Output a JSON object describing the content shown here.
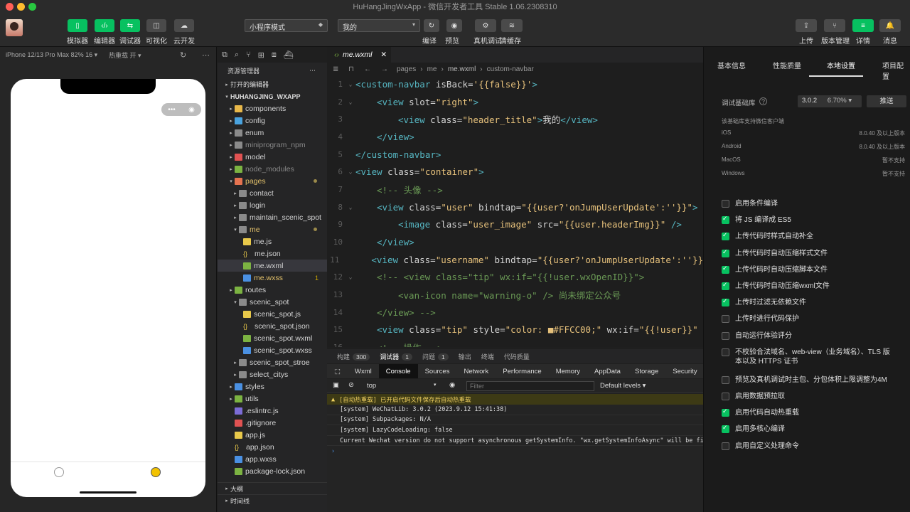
{
  "window": {
    "title": "HuHangJingWxApp - 微信开发者工具 Stable 1.06.2308310"
  },
  "toolbar": {
    "left_buttons": [
      {
        "label": "模拟器",
        "glyph": "▯"
      },
      {
        "label": "编辑器",
        "glyph": "‹/›"
      },
      {
        "label": "调试器",
        "glyph": "⇆"
      },
      {
        "label": "可视化",
        "glyph": "◫"
      },
      {
        "label": "云开发",
        "glyph": "☁"
      }
    ],
    "mode_select": "小程序模式",
    "page_select": "我的",
    "center_buttons": [
      {
        "label": "编译",
        "glyph": "↻"
      },
      {
        "label": "预览",
        "glyph": "◉"
      },
      {
        "label": "真机调试",
        "glyph": "⚙"
      },
      {
        "label": "清缓存",
        "glyph": "≋"
      }
    ],
    "right_buttons": [
      {
        "label": "上传",
        "glyph": "⇪"
      },
      {
        "label": "版本管理",
        "glyph": "⑂"
      },
      {
        "label": "详情",
        "glyph": "≡"
      },
      {
        "label": "消息",
        "glyph": "🔔"
      }
    ]
  },
  "simulator": {
    "device": "iPhone 12/13 Pro Max 82% 16 ▾",
    "hot_reload": "热重载 开 ▾"
  },
  "explorer": {
    "title": "资源管理器",
    "open_editors": "打开的编辑器",
    "root": "HUHANGJING_WXAPP",
    "items": [
      {
        "label": "components",
        "depth": 0,
        "arrow": "▸",
        "color": "#e8b84a"
      },
      {
        "label": "config",
        "depth": 0,
        "arrow": "▸",
        "color": "#4aa3df"
      },
      {
        "label": "enum",
        "depth": 0,
        "arrow": "▸",
        "color": "#8a8a8a"
      },
      {
        "label": "miniprogram_npm",
        "depth": 0,
        "arrow": "▸",
        "color": "#8a8a8a",
        "dim": true
      },
      {
        "label": "model",
        "depth": 0,
        "arrow": "▸",
        "color": "#e05252"
      },
      {
        "label": "node_modules",
        "depth": 0,
        "arrow": "▸",
        "color": "#7cb342",
        "dim": true
      },
      {
        "label": "pages",
        "depth": 0,
        "arrow": "▾",
        "color": "#e57350",
        "mod": "dot"
      },
      {
        "label": "contact",
        "depth": 1,
        "arrow": "▸",
        "color": "#8a8a8a"
      },
      {
        "label": "login",
        "depth": 1,
        "arrow": "▸",
        "color": "#8a8a8a"
      },
      {
        "label": "maintain_scenic_spot",
        "depth": 1,
        "arrow": "▸",
        "color": "#8a8a8a"
      },
      {
        "label": "me",
        "depth": 1,
        "arrow": "▾",
        "color": "#8a8a8a",
        "mod": "dot",
        "yellow": true
      },
      {
        "label": "me.js",
        "depth": 2,
        "arrow": "",
        "color": "#e8c84a"
      },
      {
        "label": "me.json",
        "depth": 2,
        "arrow": "",
        "color": "#e8c84a",
        "brace": true
      },
      {
        "label": "me.wxml",
        "depth": 2,
        "arrow": "",
        "color": "#7cb342",
        "selected": true
      },
      {
        "label": "me.wxss",
        "depth": 2,
        "arrow": "",
        "color": "#4a90e2",
        "mod": "1",
        "yellow": true
      },
      {
        "label": "routes",
        "depth": 0,
        "arrow": "▸",
        "color": "#7cb342"
      },
      {
        "label": "scenic_spot",
        "depth": 1,
        "arrow": "▾",
        "color": "#8a8a8a"
      },
      {
        "label": "scenic_spot.js",
        "depth": 2,
        "arrow": "",
        "color": "#e8c84a"
      },
      {
        "label": "scenic_spot.json",
        "depth": 2,
        "arrow": "",
        "color": "#e8c84a",
        "brace": true
      },
      {
        "label": "scenic_spot.wxml",
        "depth": 2,
        "arrow": "",
        "color": "#7cb342"
      },
      {
        "label": "scenic_spot.wxss",
        "depth": 2,
        "arrow": "",
        "color": "#4a90e2"
      },
      {
        "label": "scenic_spot_stroe",
        "depth": 1,
        "arrow": "▸",
        "color": "#8a8a8a"
      },
      {
        "label": "select_citys",
        "depth": 1,
        "arrow": "▸",
        "color": "#8a8a8a"
      },
      {
        "label": "styles",
        "depth": 0,
        "arrow": "▸",
        "color": "#4a90e2"
      },
      {
        "label": "utils",
        "depth": 0,
        "arrow": "▸",
        "color": "#7cb342"
      },
      {
        "label": ".eslintrc.js",
        "depth": 0,
        "arrow": "",
        "color": "#7c6cd6"
      },
      {
        "label": ".gitignore",
        "depth": 0,
        "arrow": "",
        "color": "#e05252"
      },
      {
        "label": "app.js",
        "depth": 0,
        "arrow": "",
        "color": "#e8c84a"
      },
      {
        "label": "app.json",
        "depth": 0,
        "arrow": "",
        "color": "#e8c84a",
        "brace": true
      },
      {
        "label": "app.wxss",
        "depth": 0,
        "arrow": "",
        "color": "#4a90e2"
      },
      {
        "label": "package-lock.json",
        "depth": 0,
        "arrow": "",
        "color": "#7cb342"
      }
    ],
    "outline": "大纲",
    "timeline": "时间线"
  },
  "editor": {
    "tab": "me.wxml",
    "breadcrumb": [
      "pages",
      "me",
      "me.wxml",
      "custom-navbar"
    ],
    "lines": [
      {
        "n": "1",
        "fold": "⌄",
        "indent": 0,
        "tokens": [
          [
            "c-tag",
            "<custom-navbar"
          ],
          [
            "c-attr",
            " isBack="
          ],
          [
            "c-str",
            "'{{false}}'"
          ],
          [
            "c-tag",
            ">"
          ]
        ]
      },
      {
        "n": "2",
        "fold": "⌄",
        "indent": 1,
        "tokens": [
          [
            "c-tag",
            "<view"
          ],
          [
            "c-attr",
            " slot="
          ],
          [
            "c-str",
            "\"right\""
          ],
          [
            "c-tag",
            ">"
          ]
        ]
      },
      {
        "n": "3",
        "fold": "",
        "indent": 2,
        "tokens": [
          [
            "c-tag",
            "<view"
          ],
          [
            "c-attr",
            " class="
          ],
          [
            "c-str",
            "\"header_title\""
          ],
          [
            "c-tag",
            ">"
          ],
          [
            "c-pun",
            "我的"
          ],
          [
            "c-tag",
            "</view>"
          ]
        ]
      },
      {
        "n": "4",
        "fold": "",
        "indent": 1,
        "tokens": [
          [
            "c-tag",
            "</view>"
          ]
        ]
      },
      {
        "n": "5",
        "fold": "",
        "indent": 0,
        "tokens": [
          [
            "c-tag",
            "</custom-navbar>"
          ]
        ]
      },
      {
        "n": "6",
        "fold": "⌄",
        "indent": 0,
        "tokens": [
          [
            "c-tag",
            "<view"
          ],
          [
            "c-attr",
            " class="
          ],
          [
            "c-str",
            "\"container\""
          ],
          [
            "c-tag",
            ">"
          ]
        ]
      },
      {
        "n": "7",
        "fold": "",
        "indent": 1,
        "tokens": [
          [
            "c-cmt",
            "<!-- 头像 -->"
          ]
        ]
      },
      {
        "n": "8",
        "fold": "⌄",
        "indent": 1,
        "tokens": [
          [
            "c-tag",
            "<view"
          ],
          [
            "c-attr",
            " class="
          ],
          [
            "c-str",
            "\"user\""
          ],
          [
            "c-attr",
            " bindtap="
          ],
          [
            "c-str",
            "\"{{user?'onJumpUserUpdate':''}}\""
          ],
          [
            "c-tag",
            ">"
          ]
        ]
      },
      {
        "n": "9",
        "fold": "",
        "indent": 2,
        "tokens": [
          [
            "c-tag",
            "<image"
          ],
          [
            "c-attr",
            " class="
          ],
          [
            "c-str",
            "\"user_image\""
          ],
          [
            "c-attr",
            " src="
          ],
          [
            "c-str",
            "\"{{user.headerImg}}\""
          ],
          [
            "c-tag",
            " />"
          ]
        ]
      },
      {
        "n": "10",
        "fold": "",
        "indent": 1,
        "tokens": [
          [
            "c-tag",
            "</view>"
          ]
        ]
      },
      {
        "n": "11",
        "fold": "",
        "indent": 1,
        "tokens": [
          [
            "c-tag",
            "<view"
          ],
          [
            "c-attr",
            " class="
          ],
          [
            "c-str",
            "\"username\""
          ],
          [
            "c-attr",
            " bindtap="
          ],
          [
            "c-str",
            "\"{{user?'onJumpUserUpdate':''}}"
          ]
        ]
      },
      {
        "n": "12",
        "fold": "⌄",
        "indent": 1,
        "tokens": [
          [
            "c-cmt",
            "<!-- <view class=\"tip\" wx:if=\"{{!user.wxOpenID}}\">"
          ]
        ]
      },
      {
        "n": "13",
        "fold": "",
        "indent": 2,
        "tokens": [
          [
            "c-cmt",
            "<van-icon name=\"warning-o\" /> 尚未绑定公众号"
          ]
        ]
      },
      {
        "n": "14",
        "fold": "",
        "indent": 1,
        "tokens": [
          [
            "c-cmt",
            "</view> -->"
          ]
        ]
      },
      {
        "n": "15",
        "fold": "",
        "indent": 1,
        "tokens": [
          [
            "c-tag",
            "<view"
          ],
          [
            "c-attr",
            " class="
          ],
          [
            "c-str",
            "\"tip\""
          ],
          [
            "c-attr",
            " style="
          ],
          [
            "c-str",
            "\"color: ■#FFCC00;\""
          ],
          [
            "c-attr",
            " wx:if="
          ],
          [
            "c-str",
            "\"{{!user}}\""
          ]
        ]
      },
      {
        "n": "16",
        "fold": "",
        "indent": 1,
        "tokens": [
          [
            "c-cmt",
            "<!-- 操作 -->"
          ]
        ]
      }
    ]
  },
  "devtools": {
    "panel_tabs": [
      {
        "label": "构建",
        "count": "300"
      },
      {
        "label": "调试器",
        "count": "1",
        "active": true
      },
      {
        "label": "问题",
        "count": "1"
      },
      {
        "label": "输出",
        "count": ""
      },
      {
        "label": "终端",
        "count": ""
      },
      {
        "label": "代码质量",
        "count": ""
      }
    ],
    "sub_tabs": [
      "Wxml",
      "Console",
      "Sources",
      "Network",
      "Performance",
      "Memory",
      "AppData",
      "Storage",
      "Security"
    ],
    "context": "top",
    "filter_placeholder": "Filter",
    "levels": "Default levels ▾",
    "warning": "[自动热重载] 已开启代码文件保存后自动热重载",
    "logs": [
      "[system] WeChatLib: 3.0.2 (2023.9.12 15:41:38)",
      "[system] Subpackages: N/A",
      "[system] LazyCodeLoading: false",
      "Current Wechat version do not support asynchronous getSystemInfo. \"wx.getSystemInfoAsync\" will be fi"
    ],
    "prompt": "›"
  },
  "details": {
    "tabs": [
      "基本信息",
      "性能质量",
      "本地设置",
      "项目配置"
    ],
    "active_tab": "本地设置",
    "lib_label": "调试基础库",
    "lib_version": "3.0.2",
    "lib_percent": "6.70% ▾",
    "push": "推送",
    "support_title": "该基础库支持微信客户端",
    "support": [
      {
        "os": "iOS",
        "val": "8.0.40 及以上版本"
      },
      {
        "os": "Android",
        "val": "8.0.40 及以上版本"
      },
      {
        "os": "MacOS",
        "val": "暂不支持"
      },
      {
        "os": "Windows",
        "val": "暂不支持"
      }
    ],
    "options": [
      {
        "label": "启用条件编译",
        "on": false
      },
      {
        "label": "将 JS 编译成 ES5",
        "on": true
      },
      {
        "label": "上传代码时样式自动补全",
        "on": true
      },
      {
        "label": "上传代码时自动压缩样式文件",
        "on": true
      },
      {
        "label": "上传代码时自动压缩脚本文件",
        "on": true
      },
      {
        "label": "上传代码时自动压缩wxml文件",
        "on": true
      },
      {
        "label": "上传时过滤无依赖文件",
        "on": true
      },
      {
        "label": "上传时进行代码保护",
        "on": false
      },
      {
        "label": "自动运行体验评分",
        "on": false
      },
      {
        "label": "不校验合法域名、web-view（业务域名）、TLS 版本以及 HTTPS 证书",
        "on": false,
        "two_line": true
      },
      {
        "label": "预览及真机调试时主包、分包体积上限调整为4M",
        "on": false
      },
      {
        "label": "启用数据预拉取",
        "on": false
      },
      {
        "label": "启用代码自动热重载",
        "on": true
      },
      {
        "label": "启用多核心编译",
        "on": true
      },
      {
        "label": "启用自定义处理命令",
        "on": false
      }
    ]
  },
  "colors": {
    "accent": "#07c160",
    "bg": "#1f1f1f"
  }
}
